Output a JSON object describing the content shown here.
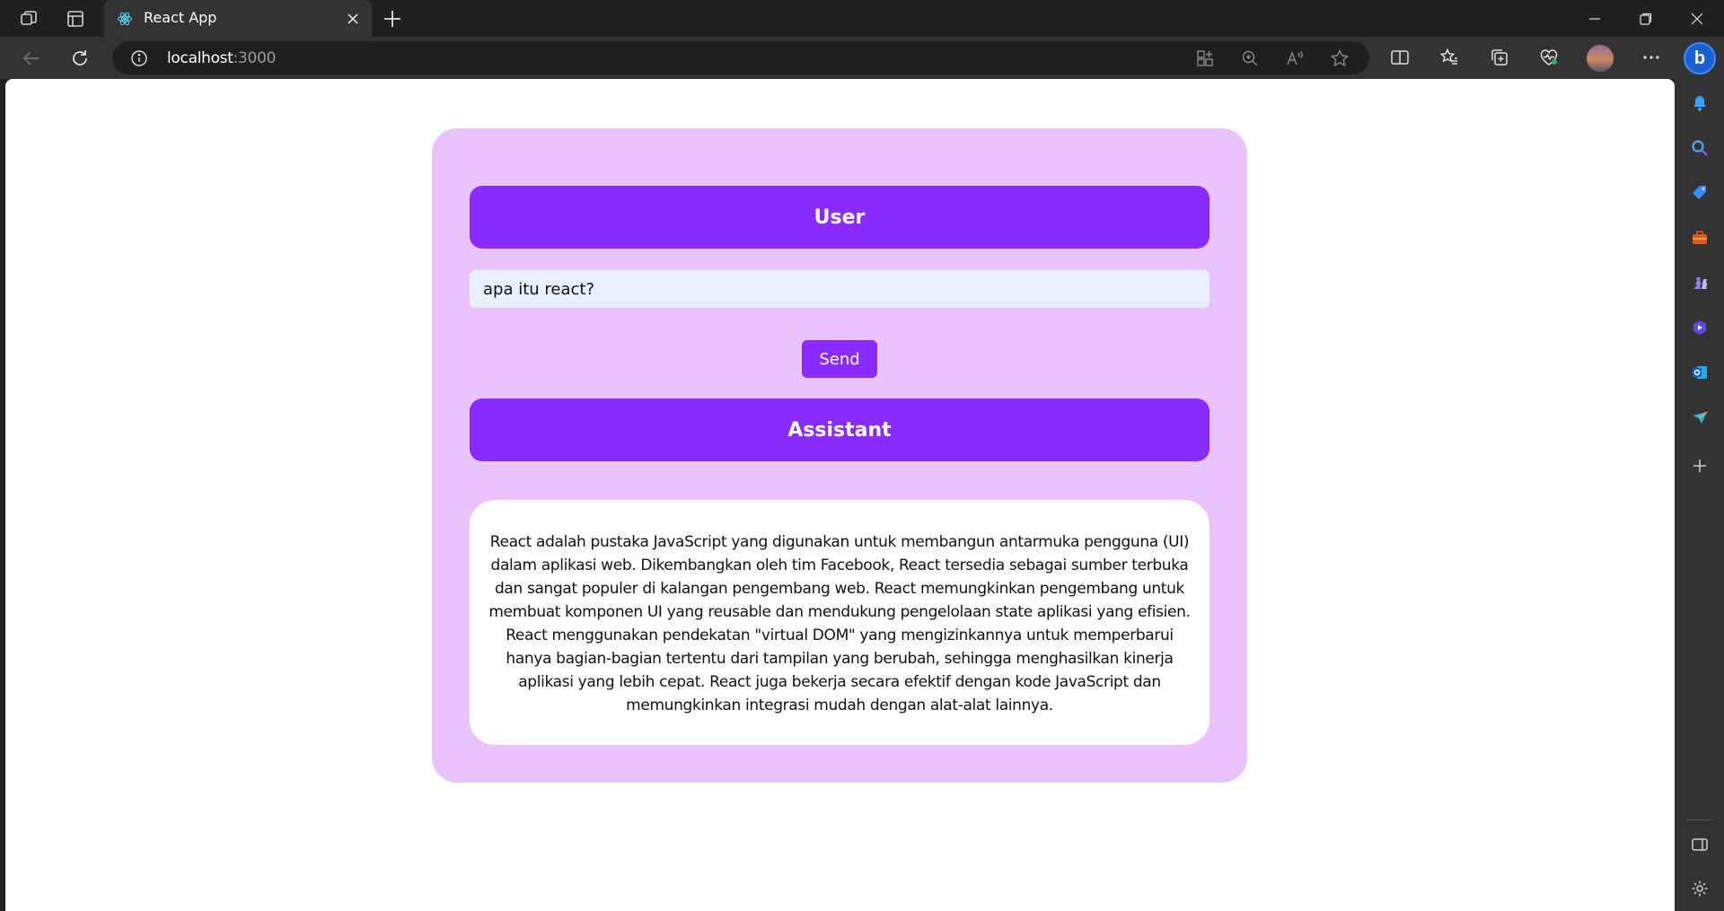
{
  "browser": {
    "tab_title": "React App",
    "url_host": "localhost",
    "url_port": ":3000"
  },
  "app": {
    "user_label": "User",
    "input_value": "apa itu react?",
    "send_label": "Send",
    "assistant_label": "Assistant",
    "response_text": "React adalah pustaka JavaScript yang digunakan untuk membangun antarmuka pengguna (UI) dalam aplikasi web. Dikembangkan oleh tim Facebook, React tersedia sebagai sumber terbuka dan sangat populer di kalangan pengembang web. React memungkinkan pengembang untuk membuat komponen UI yang reusable dan mendukung pengelolaan state aplikasi yang efisien. React menggunakan pendekatan \"virtual DOM\" yang mengizinkannya untuk memperbarui hanya bagian-bagian tertentu dari tampilan yang berubah, sehingga menghasilkan kinerja aplikasi yang lebih cepat. React juga bekerja secara efektif dengan kode JavaScript dan memungkinkan integrasi mudah dengan alat-alat lainnya."
  },
  "colors": {
    "accent_purple": "#8a2bff",
    "card_background": "#e9c3fd",
    "input_background": "#e8f0fd"
  }
}
